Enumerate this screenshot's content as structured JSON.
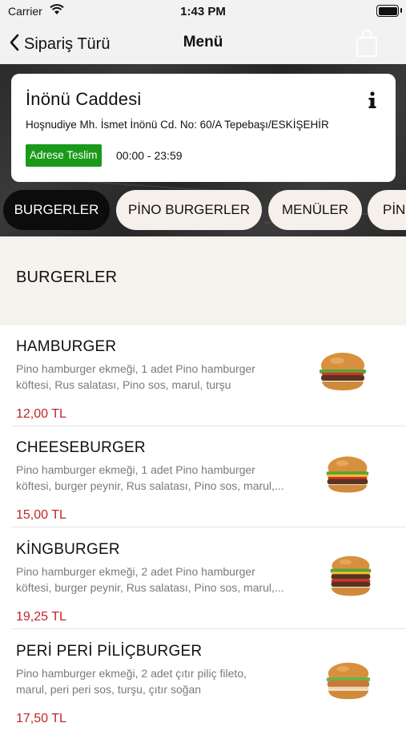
{
  "status_bar": {
    "carrier": "Carrier",
    "time": "1:43 PM"
  },
  "nav": {
    "back_label": "Sipariş Türü",
    "title": "Menü"
  },
  "branch": {
    "name": "İnönü Caddesi",
    "address": "Hoşnudiye Mh. İsmet İnönü Cd. No: 60/A  Tepebaşı/ESKİŞEHİR",
    "delivery_badge": "Adrese Teslim",
    "hours": "00:00 - 23:59"
  },
  "tabs": [
    {
      "label": "BURGERLER",
      "active": true
    },
    {
      "label": "PİNO BURGERLER",
      "active": false
    },
    {
      "label": "MENÜLER",
      "active": false
    },
    {
      "label": "PİNO",
      "active": false
    }
  ],
  "section": {
    "title": "BURGERLER"
  },
  "items": [
    {
      "name": "HAMBURGER",
      "desc_line1": "Pino hamburger ekmeği, 1 adet Pino hamburger",
      "desc_line2": "köftesi, Rus salatası, Pino sos, marul, turşu",
      "price": "12,00 TL"
    },
    {
      "name": "CHEESEBURGER",
      "desc_line1": "Pino hamburger ekmeği, 1 adet Pino hamburger",
      "desc_line2": "köftesi, burger peynir, Rus salatası, Pino sos, marul,...",
      "price": "15,00 TL"
    },
    {
      "name": "KİNGBURGER",
      "desc_line1": "Pino hamburger ekmeği, 2 adet Pino hamburger",
      "desc_line2": "köftesi, burger peynir, Rus salatası, Pino sos, marul,...",
      "price": "19,25 TL"
    },
    {
      "name": "PERİ PERİ PİLİÇBURGER",
      "desc_line1": "Pino hamburger ekmeği, 2 adet çıtır piliç fileto,",
      "desc_line2": "marul, peri peri sos, turşu, çıtır soğan",
      "price": "17,50 TL"
    }
  ],
  "colors": {
    "active_tab": "#0c0c0c",
    "price": "#c4242a",
    "badge": "#1a9a1a"
  },
  "icons": [
    "wifi-icon",
    "battery-icon",
    "back-chevron-icon",
    "shopping-bag-icon",
    "info-icon",
    "burger-image"
  ]
}
